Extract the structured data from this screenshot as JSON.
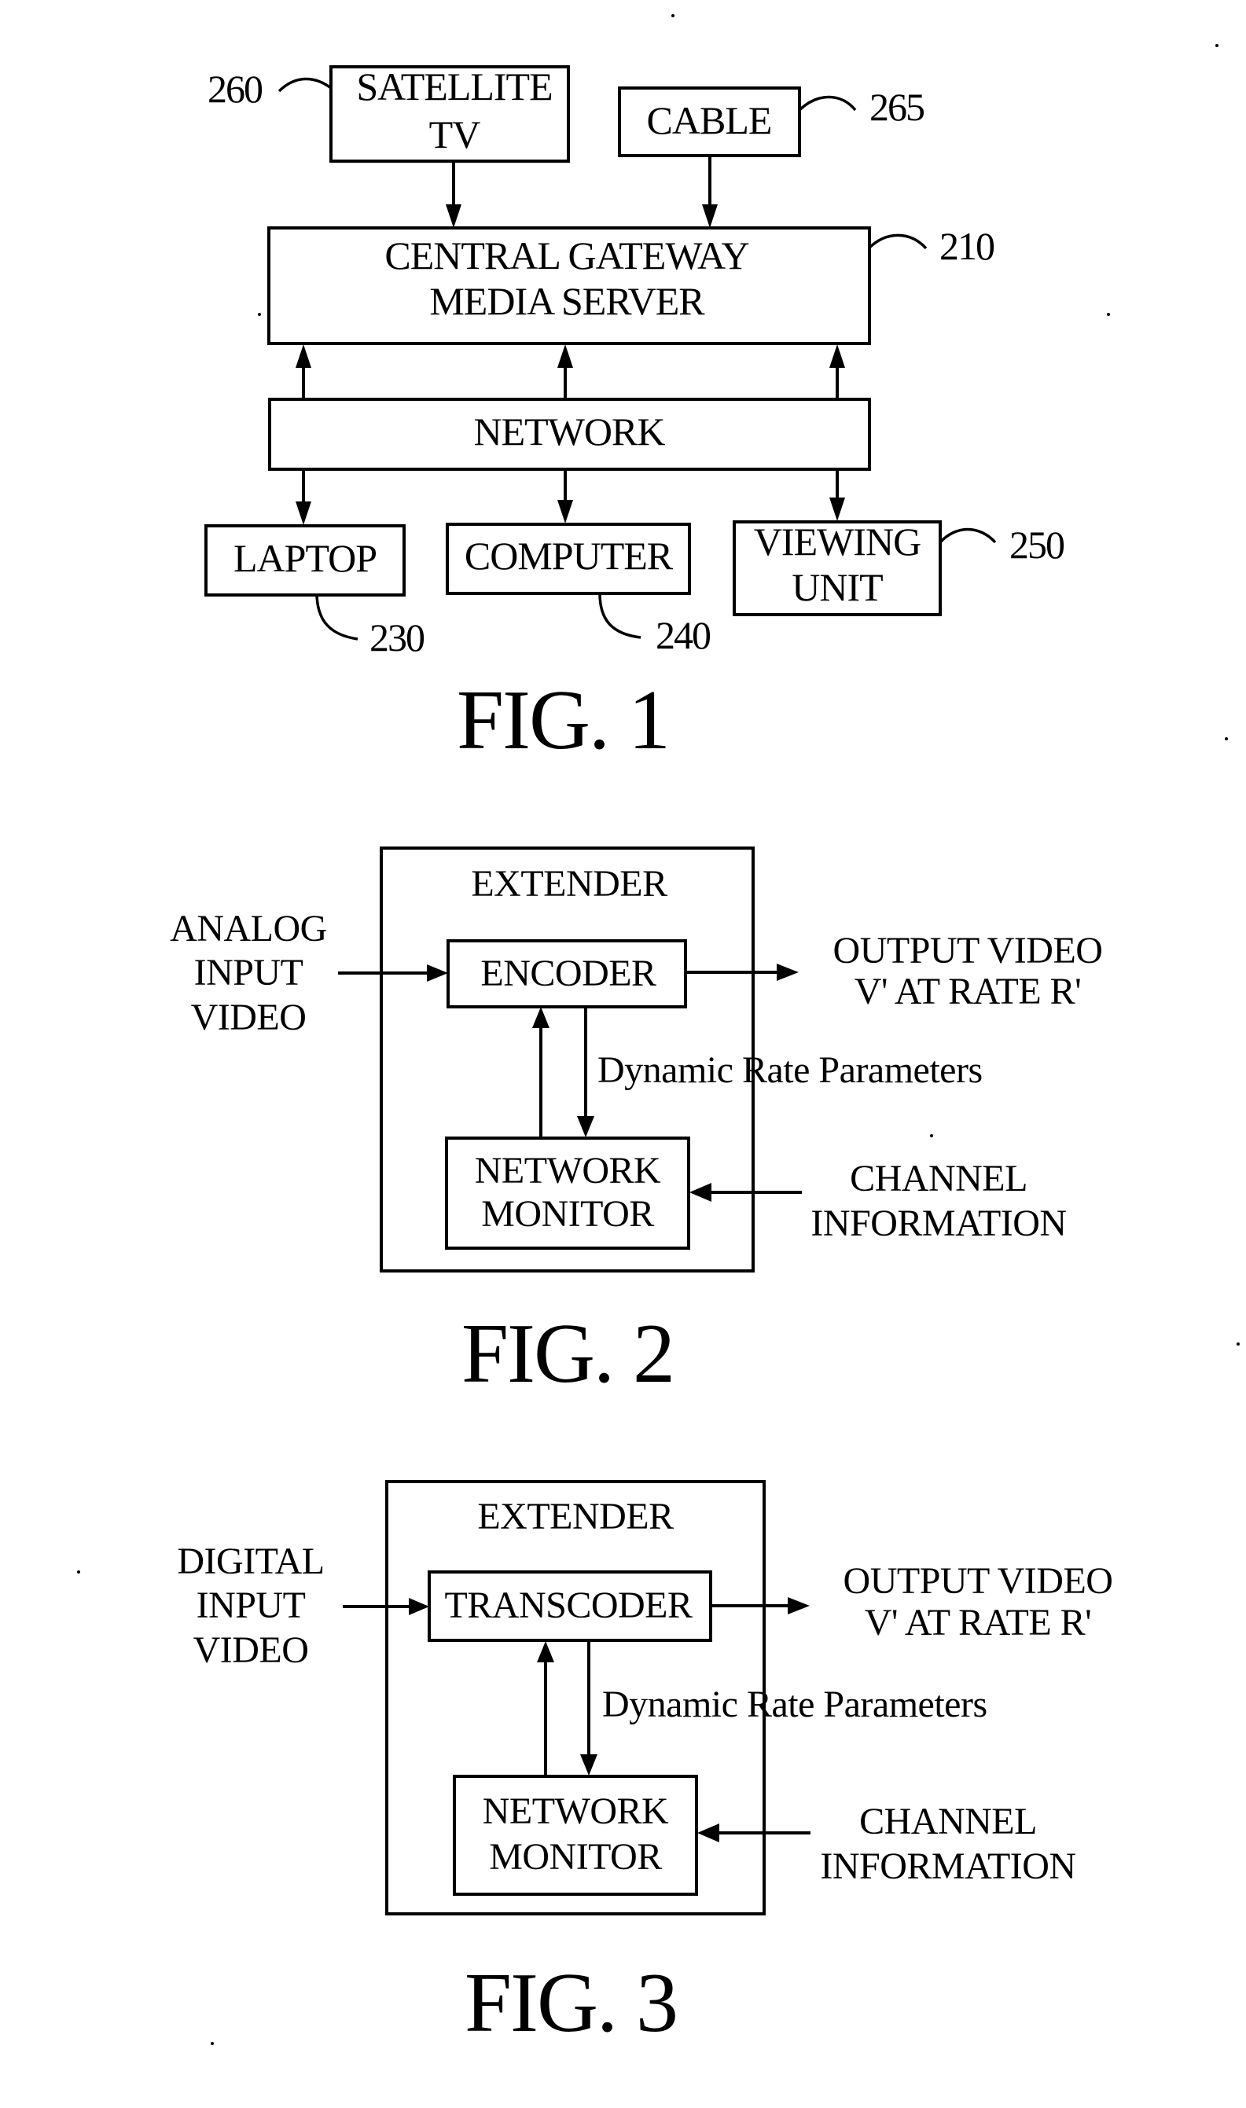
{
  "figures": [
    {
      "title": "FIG. 1",
      "nodes": {
        "satellite": {
          "lines": [
            "SATELLITE",
            "TV"
          ],
          "ref": "260"
        },
        "cable": {
          "lines": [
            "CABLE"
          ],
          "ref": "265"
        },
        "gateway": {
          "lines": [
            "CENTRAL GATEWAY",
            "MEDIA SERVER"
          ],
          "ref": "210"
        },
        "network": {
          "lines": [
            "NETWORK"
          ]
        },
        "laptop": {
          "lines": [
            "LAPTOP"
          ],
          "ref": "230"
        },
        "computer": {
          "lines": [
            "COMPUTER"
          ],
          "ref": "240"
        },
        "viewing_unit": {
          "lines": [
            "VIEWING",
            "UNIT"
          ],
          "ref": "250"
        }
      },
      "edges": [
        {
          "from": "satellite",
          "to": "gateway"
        },
        {
          "from": "cable",
          "to": "gateway"
        },
        {
          "from": "network",
          "to": "gateway"
        },
        {
          "from": "network",
          "to": "gateway"
        },
        {
          "from": "network",
          "to": "gateway"
        },
        {
          "from": "network",
          "to": "laptop"
        },
        {
          "from": "network",
          "to": "computer"
        },
        {
          "from": "network",
          "to": "viewing_unit"
        }
      ]
    },
    {
      "title": "FIG. 2",
      "container": "EXTENDER",
      "input_lines": [
        "ANALOG",
        "INPUT",
        "VIDEO"
      ],
      "processor": "ENCODER",
      "monitor_lines": [
        "NETWORK",
        "MONITOR"
      ],
      "output_lines": [
        "OUTPUT VIDEO",
        "V' AT RATE R'"
      ],
      "feedback_label": "Dynamic Rate Parameters",
      "channel_lines": [
        "CHANNEL",
        "INFORMATION"
      ]
    },
    {
      "title": "FIG. 3",
      "container": "EXTENDER",
      "input_lines": [
        "DIGITAL",
        "INPUT",
        "VIDEO"
      ],
      "processor": "TRANSCODER",
      "monitor_lines": [
        "NETWORK",
        "MONITOR"
      ],
      "output_lines": [
        "OUTPUT VIDEO",
        "V' AT RATE R'"
      ],
      "feedback_label": "Dynamic Rate Parameters",
      "channel_lines": [
        "CHANNEL",
        "INFORMATION"
      ]
    }
  ]
}
